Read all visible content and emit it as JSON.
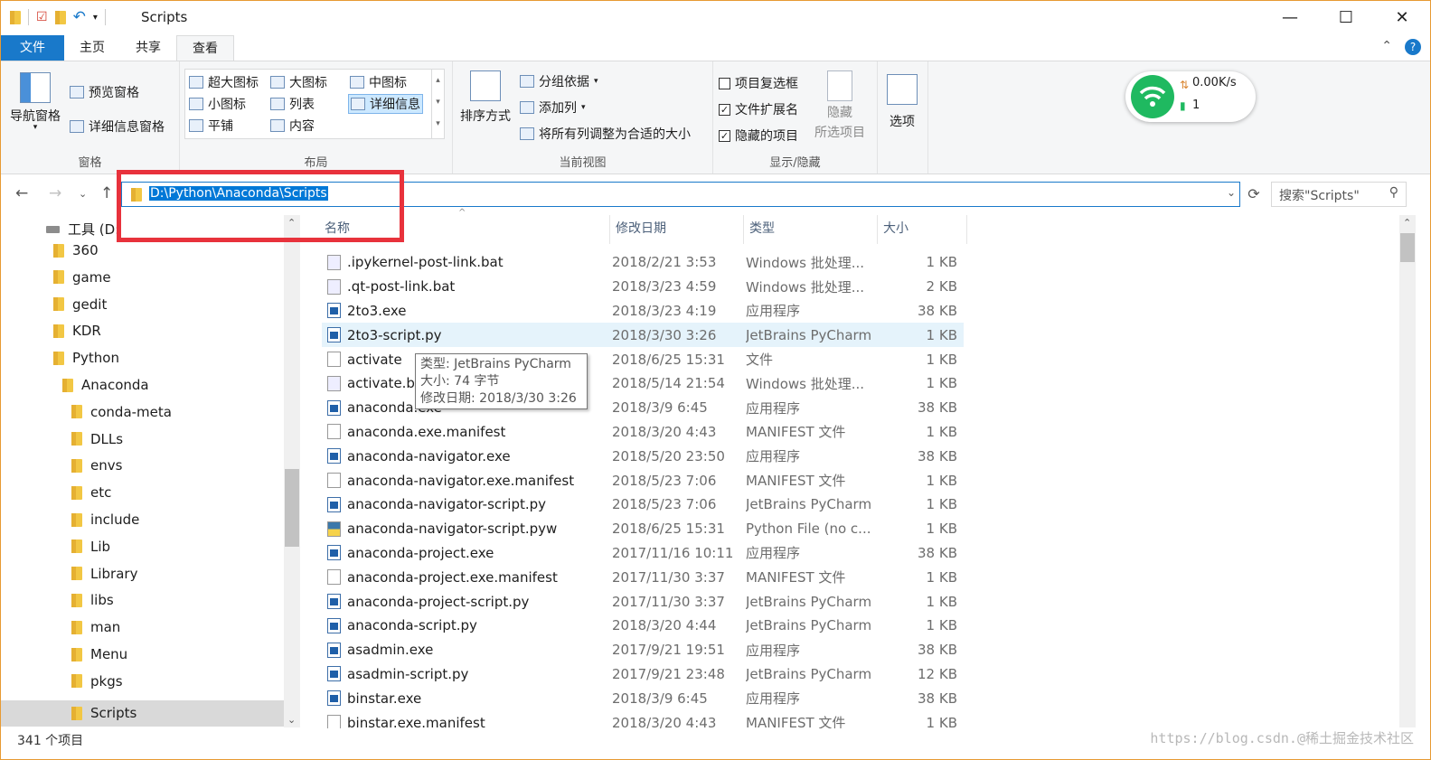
{
  "window": {
    "title": "Scripts",
    "minimize": "—",
    "maximize": "☐",
    "close": "✕"
  },
  "ribbon_tabs": {
    "file": "文件",
    "home": "主页",
    "share": "共享",
    "view": "查看"
  },
  "ribbon": {
    "panes": {
      "nav_pane": "导航窗格",
      "preview_pane": "预览窗格",
      "details_pane": "详细信息窗格",
      "label": "窗格"
    },
    "layout": {
      "extra_large": "超大图标",
      "large": "大图标",
      "medium": "中图标",
      "small": "小图标",
      "list": "列表",
      "details": "详细信息",
      "tiles": "平铺",
      "content": "内容",
      "label": "布局"
    },
    "current_view": {
      "sort_by": "排序方式",
      "group_by": "分组依据",
      "add_columns": "添加列",
      "size_all_columns": "将所有列调整为合适的大小",
      "label": "当前视图"
    },
    "show_hide": {
      "item_checkboxes": "项目复选框",
      "file_extensions": "文件扩展名",
      "hidden_items": "隐藏的项目",
      "hide_line1": "隐藏",
      "hide_line2": "所选项目",
      "label": "显示/隐藏",
      "item_checkboxes_checked": false,
      "file_extensions_checked": true,
      "hidden_items_checked": true
    },
    "options": "选项"
  },
  "wifi_widget": {
    "speed": "0.00K/s",
    "devices": "1",
    "accent": "#1fb960"
  },
  "address": {
    "path": "D:\\Python\\Anaconda\\Scripts",
    "search_placeholder": "搜索\"Scripts\""
  },
  "nav_pane": {
    "drive": "工具 (D:",
    "items": [
      "360",
      "game",
      "gedit",
      "KDR",
      "Python",
      "Anaconda",
      "conda-meta",
      "DLLs",
      "envs",
      "etc",
      "include",
      "Lib",
      "Library",
      "libs",
      "man",
      "Menu",
      "pkgs",
      "Scripts"
    ],
    "selected": "Scripts"
  },
  "columns": {
    "name": "名称",
    "date": "修改日期",
    "type": "类型",
    "size": "大小"
  },
  "files": [
    {
      "name": ".ipykernel-post-link.bat",
      "date": "2018/2/21 3:53",
      "type": "Windows 批处理...",
      "size": "1 KB",
      "icon": "bat-icon"
    },
    {
      "name": ".qt-post-link.bat",
      "date": "2018/3/23 4:59",
      "type": "Windows 批处理...",
      "size": "2 KB",
      "icon": "bat-icon"
    },
    {
      "name": "2to3.exe",
      "date": "2018/3/23 4:19",
      "type": "应用程序",
      "size": "38 KB",
      "icon": "exe-icon"
    },
    {
      "name": "2to3-script.py",
      "date": "2018/3/30 3:26",
      "type": "JetBrains PyCharm",
      "size": "1 KB",
      "icon": "pycharm-file-icon"
    },
    {
      "name": "activate",
      "date": "2018/6/25 15:31",
      "type": "文件",
      "size": "1 KB",
      "icon": "file-icon"
    },
    {
      "name": "activate.bat",
      "date": "2018/5/14 21:54",
      "type": "Windows 批处理...",
      "size": "1 KB",
      "icon": "bat-icon"
    },
    {
      "name": "anaconda.exe",
      "date": "2018/3/9 6:45",
      "type": "应用程序",
      "size": "38 KB",
      "icon": "exe-icon"
    },
    {
      "name": "anaconda.exe.manifest",
      "date": "2018/3/20 4:43",
      "type": "MANIFEST 文件",
      "size": "1 KB",
      "icon": "file-icon"
    },
    {
      "name": "anaconda-navigator.exe",
      "date": "2018/5/20 23:50",
      "type": "应用程序",
      "size": "38 KB",
      "icon": "exe-icon"
    },
    {
      "name": "anaconda-navigator.exe.manifest",
      "date": "2018/5/23 7:06",
      "type": "MANIFEST 文件",
      "size": "1 KB",
      "icon": "file-icon"
    },
    {
      "name": "anaconda-navigator-script.py",
      "date": "2018/5/23 7:06",
      "type": "JetBrains PyCharm",
      "size": "1 KB",
      "icon": "pycharm-file-icon"
    },
    {
      "name": "anaconda-navigator-script.pyw",
      "date": "2018/6/25 15:31",
      "type": "Python File (no c...",
      "size": "1 KB",
      "icon": "python-file-icon"
    },
    {
      "name": "anaconda-project.exe",
      "date": "2017/11/16 10:11",
      "type": "应用程序",
      "size": "38 KB",
      "icon": "exe-icon"
    },
    {
      "name": "anaconda-project.exe.manifest",
      "date": "2017/11/30 3:37",
      "type": "MANIFEST 文件",
      "size": "1 KB",
      "icon": "file-icon"
    },
    {
      "name": "anaconda-project-script.py",
      "date": "2017/11/30 3:37",
      "type": "JetBrains PyCharm",
      "size": "1 KB",
      "icon": "pycharm-file-icon"
    },
    {
      "name": "anaconda-script.py",
      "date": "2018/3/20 4:44",
      "type": "JetBrains PyCharm",
      "size": "1 KB",
      "icon": "pycharm-file-icon"
    },
    {
      "name": "asadmin.exe",
      "date": "2017/9/21 19:51",
      "type": "应用程序",
      "size": "38 KB",
      "icon": "exe-icon"
    },
    {
      "name": "asadmin-script.py",
      "date": "2017/9/21 23:48",
      "type": "JetBrains PyCharm",
      "size": "12 KB",
      "icon": "pycharm-file-icon"
    },
    {
      "name": "binstar.exe",
      "date": "2018/3/9 6:45",
      "type": "应用程序",
      "size": "38 KB",
      "icon": "exe-icon"
    },
    {
      "name": "binstar.exe.manifest",
      "date": "2018/3/20 4:43",
      "type": "MANIFEST 文件",
      "size": "1 KB",
      "icon": "file-icon"
    }
  ],
  "selected_file": "2to3-script.py",
  "tooltip": {
    "type_line": "类型: JetBrains PyCharm",
    "size_line": "大小: 74 字节",
    "date_line": "修改日期: 2018/3/30 3:26"
  },
  "status": {
    "count": "341 个项目"
  },
  "watermark": "https://blog.csdn.@稀土掘金技术社区",
  "colors": {
    "accent": "#1979ca",
    "highlight_box": "#e8323c",
    "selection": "#0078d7"
  }
}
